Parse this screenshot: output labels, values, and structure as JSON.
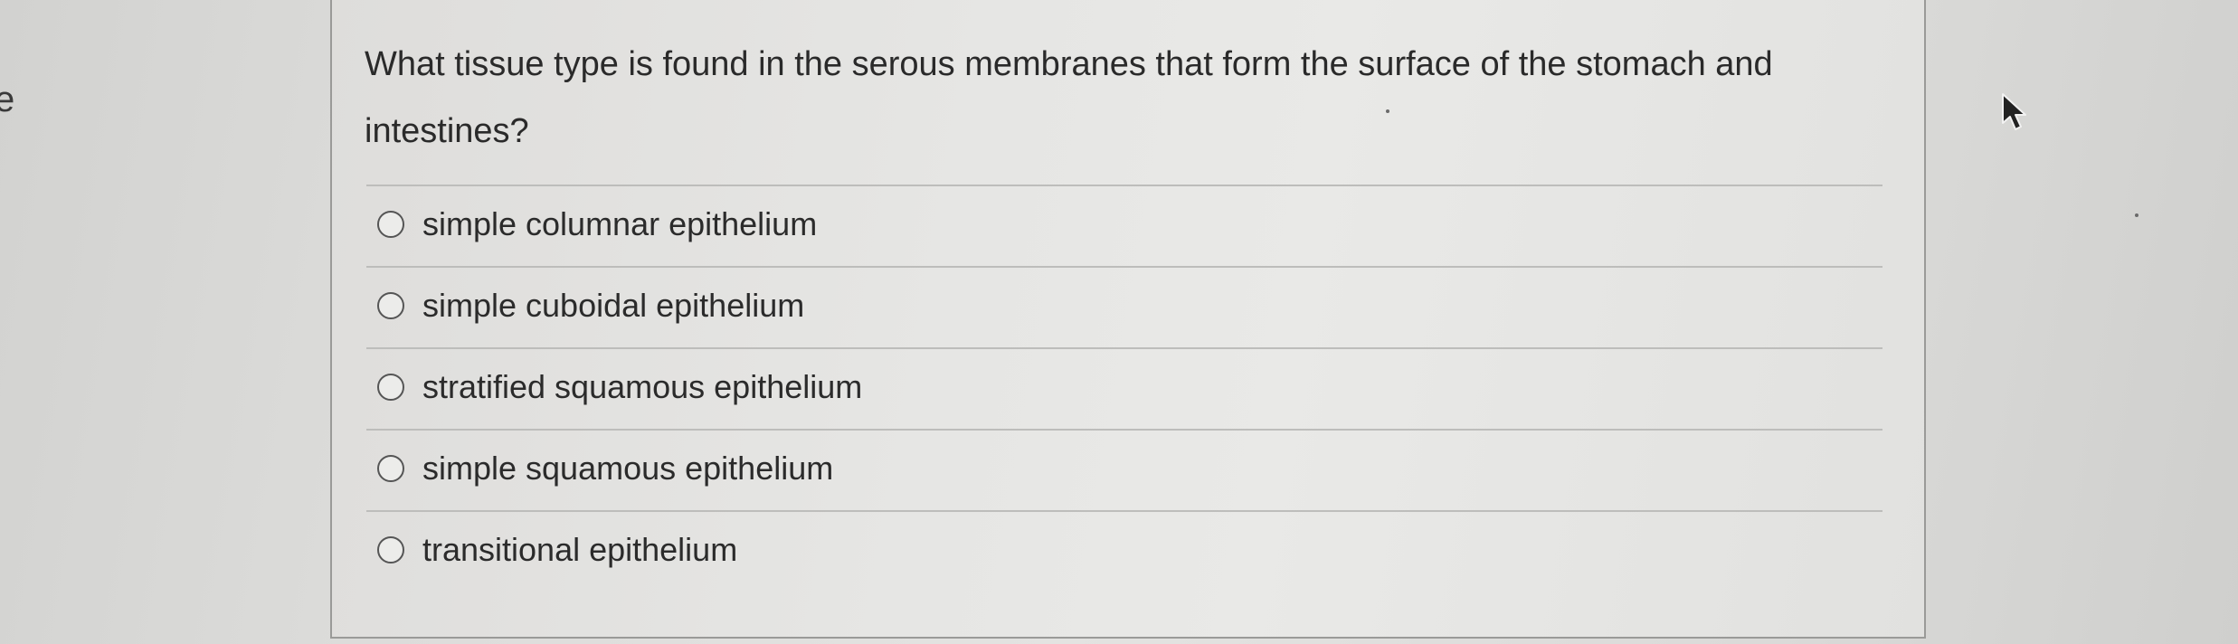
{
  "left_fragment": "e",
  "question": {
    "text": "What tissue type is found in the serous membranes that form the surface of the stomach and intestines?"
  },
  "options": [
    {
      "label": "simple columnar epithelium",
      "selected": false
    },
    {
      "label": "simple cuboidal epithelium",
      "selected": false
    },
    {
      "label": "stratified squamous epithelium",
      "selected": false
    },
    {
      "label": "simple squamous epithelium",
      "selected": false
    },
    {
      "label": "transitional epithelium",
      "selected": false
    }
  ],
  "icons": {
    "cursor": "mouse-pointer-icon",
    "radio": "radio-unselected-icon"
  },
  "colors": {
    "panel_border": "#9a9a98",
    "text": "#2a2a2a",
    "separator": "#bdbdbb"
  }
}
